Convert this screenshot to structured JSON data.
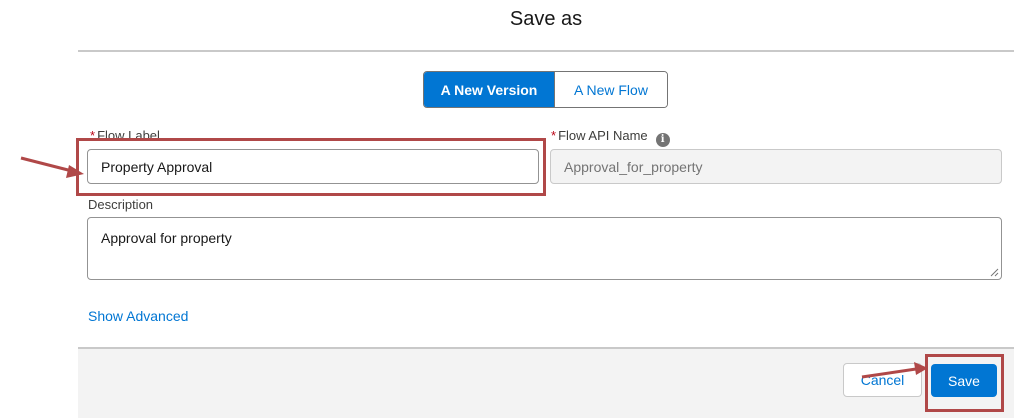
{
  "modal": {
    "title": "Save as"
  },
  "toggle": {
    "options": [
      "A New Version",
      "A New Flow"
    ],
    "selected": "A New Version"
  },
  "form": {
    "flow_label": {
      "label": "Flow Label",
      "required": "*",
      "value": "Property Approval"
    },
    "flow_api_name": {
      "label": "Flow API Name",
      "required": "*",
      "value": "Approval_for_property",
      "info_icon": "info-icon"
    },
    "description": {
      "label": "Description",
      "value": "Approval for property"
    },
    "show_advanced": "Show Advanced"
  },
  "footer": {
    "cancel": "Cancel",
    "save": "Save"
  },
  "colors": {
    "brand": "#0176d3",
    "annotation": "#b04848"
  }
}
